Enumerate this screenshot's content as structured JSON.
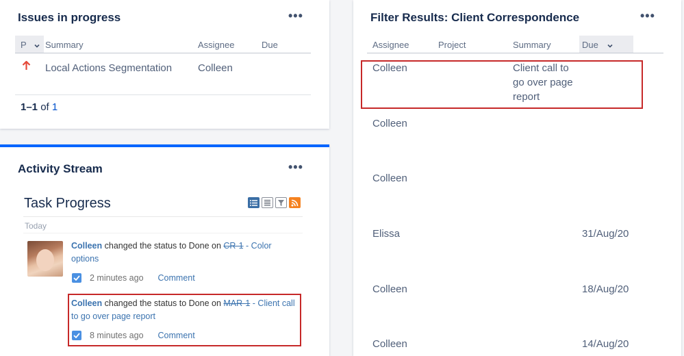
{
  "issues": {
    "title": "Issues in progress",
    "more": "•••",
    "headers": {
      "priority": "P",
      "summary": "Summary",
      "assignee": "Assignee",
      "due": "Due"
    },
    "row": {
      "priority_icon": "arrow-up-icon",
      "summary": "Local Actions Segmentation",
      "assignee": "Colleen",
      "due": ""
    },
    "pager": {
      "range": "1–1",
      "of": "of",
      "total": "1"
    }
  },
  "activity": {
    "title": "Activity Stream",
    "more": "•••",
    "subtitle": "Task Progress",
    "date_group": "Today",
    "icons": [
      "list-view-icon",
      "full-view-icon",
      "filter-icon",
      "rss-icon"
    ],
    "entries": [
      {
        "user": "Colleen",
        "action": "changed the status to Done on",
        "issue_key": "CR-1",
        "issue_title": "- Color options",
        "time": "2 minutes ago",
        "comment": "Comment"
      },
      {
        "user": "Colleen",
        "action": "changed the status to Done on",
        "issue_key": "MAR-1",
        "issue_title": "- Client call to go over page report",
        "time": "8 minutes ago",
        "comment": "Comment"
      }
    ]
  },
  "filter": {
    "title": "Filter Results: Client Correspondence",
    "more": "•••",
    "headers": {
      "assignee": "Assignee",
      "project": "Project",
      "summary": "Summary",
      "due": "Due"
    },
    "rows": [
      {
        "assignee": "Colleen",
        "project": "",
        "summary": "Client call to go over page report",
        "due": ""
      },
      {
        "assignee": "Colleen",
        "project": "",
        "summary": "",
        "due": ""
      },
      {
        "assignee": "Colleen",
        "project": "",
        "summary": "",
        "due": ""
      },
      {
        "assignee": "Elissa",
        "project": "",
        "summary": "",
        "due": "31/Aug/20"
      },
      {
        "assignee": "Colleen",
        "project": "",
        "summary": "",
        "due": "18/Aug/20"
      },
      {
        "assignee": "Colleen",
        "project": "",
        "summary": "",
        "due": "14/Aug/20"
      }
    ]
  }
}
